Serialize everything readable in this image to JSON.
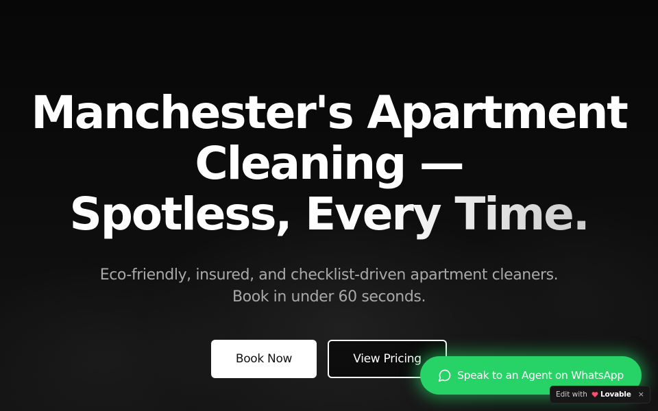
{
  "hero": {
    "headline_line1": "Manchester's Apartment",
    "headline_line2": "Cleaning —",
    "headline_line3": "Spotless, Every Time.",
    "subheadline_line1": "Eco-friendly, insured, and checklist-driven apartment cleaners.",
    "subheadline_line2": "Book in under 60 seconds."
  },
  "cta": {
    "primary_label": "Book Now",
    "secondary_label": "View Pricing"
  },
  "whatsapp": {
    "label": "Speak to an Agent on WhatsApp",
    "icon": "chat-bubble-icon",
    "color": "#27d366"
  },
  "lovable_badge": {
    "edit_label": "Edit with",
    "brand_label": "Lovable",
    "close_label": "×",
    "heart_color": "#ff4d6d"
  },
  "colors": {
    "background": "#050505",
    "headline": "#ffffff",
    "subheadline": "#a9a9a9"
  }
}
